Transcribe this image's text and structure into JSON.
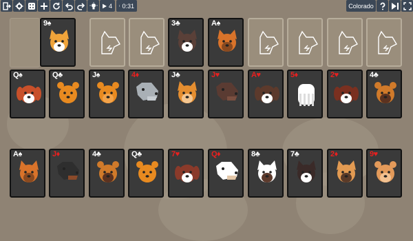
{
  "toolbar": {
    "buttons": [
      {
        "name": "exit-button",
        "icon": "exit-icon"
      },
      {
        "name": "settings-button",
        "icon": "gear-icon"
      },
      {
        "name": "dice-button",
        "icon": "dice-icon"
      },
      {
        "name": "new-game-button",
        "icon": "plus-icon"
      },
      {
        "name": "restart-button",
        "icon": "restart-icon"
      },
      {
        "name": "undo-button",
        "icon": "undo-icon"
      },
      {
        "name": "redo-button",
        "icon": "redo-icon"
      },
      {
        "name": "hint-button",
        "icon": "lightbulb-icon"
      }
    ],
    "moves": "4",
    "time": "0:31",
    "game_name": "Colorado",
    "help_icon": "question-icon",
    "skip_icon": "skip-forward-icon"
  },
  "foundations": [
    {
      "rank": "9",
      "suit": "♠",
      "color": "black",
      "dog": "corgi"
    },
    {
      "rank": "",
      "suit": "",
      "color": "",
      "dog": "slot"
    },
    {
      "rank": "",
      "suit": "",
      "color": "",
      "dog": "slot"
    },
    {
      "rank": "3",
      "suit": "♣",
      "color": "black",
      "dog": "husky"
    },
    {
      "rank": "A",
      "suit": "♠",
      "color": "black",
      "dog": "yorkie"
    },
    {
      "rank": "",
      "suit": "",
      "color": "",
      "dog": "slot"
    },
    {
      "rank": "",
      "suit": "",
      "color": "",
      "dog": "slot"
    },
    {
      "rank": "",
      "suit": "",
      "color": "",
      "dog": "slot"
    },
    {
      "rank": "",
      "suit": "",
      "color": "",
      "dog": "slot"
    }
  ],
  "row2": [
    {
      "rank": "Q",
      "suit": "♠",
      "color": "black",
      "dog": "stbernard"
    },
    {
      "rank": "Q",
      "suit": "♣",
      "color": "black",
      "dog": "chow"
    },
    {
      "rank": "J",
      "suit": "♠",
      "color": "black",
      "dog": "pomeranian"
    },
    {
      "rank": "4",
      "suit": "♦",
      "color": "red",
      "dog": "bullterrier"
    },
    {
      "rank": "J",
      "suit": "♣",
      "color": "black",
      "dog": "chihuahua"
    },
    {
      "rank": "J",
      "suit": "♥",
      "color": "red",
      "dog": "dachshund"
    },
    {
      "rank": "A",
      "suit": "♥",
      "color": "red",
      "dog": "beagle"
    },
    {
      "rank": "5",
      "suit": "♦",
      "color": "red",
      "dog": "komondor"
    },
    {
      "rank": "2",
      "suit": "♥",
      "color": "red",
      "dog": "cavalier"
    },
    {
      "rank": "4",
      "suit": "♣",
      "color": "black",
      "dog": "pug"
    }
  ],
  "row3": [
    {
      "rank": "A",
      "suit": "♠",
      "color": "black",
      "dog": "yorkie"
    },
    {
      "rank": "J",
      "suit": "♦",
      "color": "red",
      "dog": "rottweiler"
    },
    {
      "rank": "4",
      "suit": "♣",
      "color": "black",
      "dog": "pug"
    },
    {
      "rank": "Q",
      "suit": "♣",
      "color": "black",
      "dog": "chow"
    },
    {
      "rank": "7",
      "suit": "♥",
      "color": "red",
      "dog": "spaniel"
    },
    {
      "rank": "Q",
      "suit": "♦",
      "color": "red",
      "dog": "bulldog"
    },
    {
      "rank": "8",
      "suit": "♣",
      "color": "black",
      "dog": "terrier"
    },
    {
      "rank": "7",
      "suit": "♣",
      "color": "black",
      "dog": "bordercollie"
    },
    {
      "rank": "2",
      "suit": "♦",
      "color": "red",
      "dog": "shepherd"
    },
    {
      "rank": "9",
      "suit": "♥",
      "color": "red",
      "dog": "shiba"
    }
  ]
}
